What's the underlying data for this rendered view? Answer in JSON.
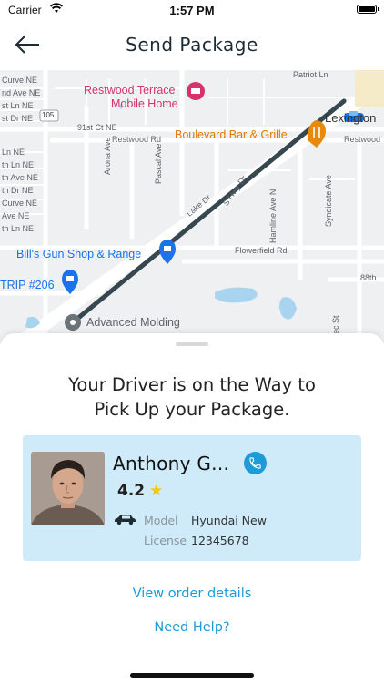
{
  "status_bar": {
    "carrier": "Carrier",
    "time": "1:57 PM"
  },
  "nav": {
    "title": "Send Package",
    "back_icon": "arrow-left-icon"
  },
  "map": {
    "streets": [
      "Curve NE",
      "nd Ave NE",
      "st Ln NE",
      "st Dr NE",
      "Ln NE",
      "th Ln NE",
      "th Ave NE",
      "th Dr NE",
      "Curve NE",
      "Ave NE",
      "th Ln NE",
      "Patriot Ln",
      "91st Ct NE",
      "Restwood Rd",
      "Restwood",
      "Arona Ave",
      "Pascal Ave",
      "Lake Dr",
      "S Hwy Dr",
      "Hamline Ave N",
      "Syndicate Ave",
      "Flowerfield Rd",
      "88th",
      "ec St",
      "105"
    ],
    "pois": {
      "restwood": "Restwood Terrace Mobile Home",
      "restwood_line1": "Restwood Terrace",
      "restwood_line2": "Mobile Home",
      "bar": "Boulevard Bar & Grille",
      "gunshop": "Bill's Gun Shop & Range",
      "trip": "TRIP #206",
      "molding": "Advanced Molding",
      "city": "Lexington"
    },
    "colors": {
      "route": "#37474f",
      "road": "#ffffff",
      "water": "#a8d4f0",
      "pink": "#d6336c",
      "orange": "#e8890c",
      "blue": "#1a73e8"
    }
  },
  "sheet": {
    "headline_line1": "Your Driver is on the Way to",
    "headline_line2": "Pick Up your Package.",
    "driver": {
      "name": "Anthony G...",
      "rating": "4.2",
      "model_label": "Model",
      "model_value": "Hyundai New",
      "license_label": "License",
      "license_value": "12345678"
    },
    "view_order": "View order details",
    "need_help": "Need Help?"
  },
  "icons": {
    "call": "phone-icon",
    "star": "star-icon",
    "car": "car-icon",
    "wifi": "wifi-icon",
    "battery": "battery-icon"
  },
  "accent": "#1b9bd7",
  "card_bg": "#cfeaf9"
}
